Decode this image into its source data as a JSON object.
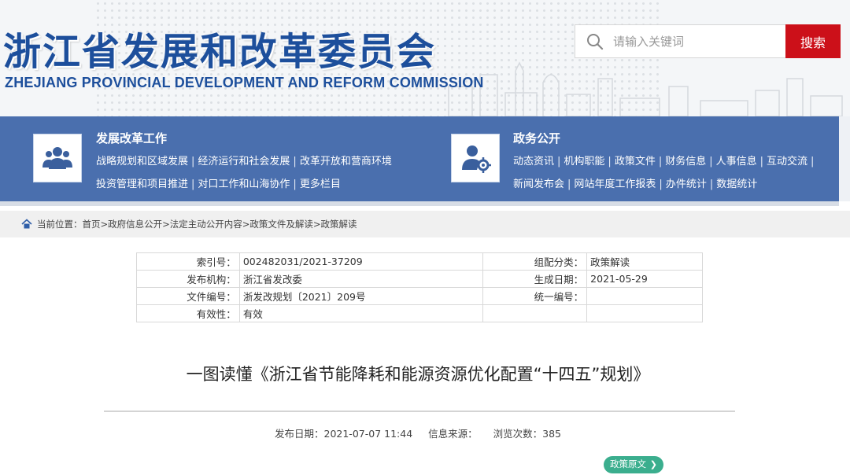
{
  "header": {
    "title_cn": "浙江省发展和改革委员会",
    "title_en": "ZHEJIANG PROVINCIAL DEVELOPMENT AND REFORM COMMISSION",
    "search_placeholder": "请输入关键词",
    "search_button": "搜索"
  },
  "nav": {
    "groups": [
      {
        "icon": "people-group-icon",
        "heading": "发展改革工作",
        "lines": [
          [
            "战略规划和区域发展",
            "经济运行和社会发展",
            "改革开放和营商环境"
          ],
          [
            "投资管理和项目推进",
            "对口工作和山海协作",
            "更多栏目"
          ]
        ]
      },
      {
        "icon": "user-gear-icon",
        "heading": "政务公开",
        "lines": [
          [
            "动态资讯",
            "机构职能",
            "政策文件",
            "财务信息",
            "人事信息",
            "互动交流"
          ],
          [
            "新闻发布会",
            "网站年度工作报表",
            "办件统计",
            "数据统计"
          ]
        ]
      }
    ]
  },
  "breadcrumb": {
    "text": "当前位置：首页>政府信息公开>法定主动公开内容>政策文件及解读>政策解读"
  },
  "info": {
    "rows": [
      {
        "k1": "索引号：",
        "v1": "002482031/2021-37209",
        "k2": "组配分类：",
        "v2": "政策解读"
      },
      {
        "k1": "发布机构：",
        "v1": "浙江省发改委",
        "k2": "生成日期：",
        "v2": "2021-05-29"
      },
      {
        "k1": "文件编号：",
        "v1": "浙发改规划〔2021〕209号",
        "k2": "统一编号：",
        "v2": ""
      },
      {
        "k1": "有效性：",
        "v1": "有效",
        "k2": "",
        "v2": ""
      }
    ]
  },
  "article": {
    "title": "一图读懂《浙江省节能降耗和能源资源优化配置“十四五”规划》",
    "publish_date": "发布日期：2021-07-07 11:44",
    "source": "信息来源：",
    "views": "浏览次数：385",
    "policy_button": "政策原文"
  },
  "colors": {
    "brand_blue": "#1d4f9c",
    "nav_blue": "#4a6fae",
    "search_red": "#cc1019",
    "policy_green": "#3bae8e"
  }
}
